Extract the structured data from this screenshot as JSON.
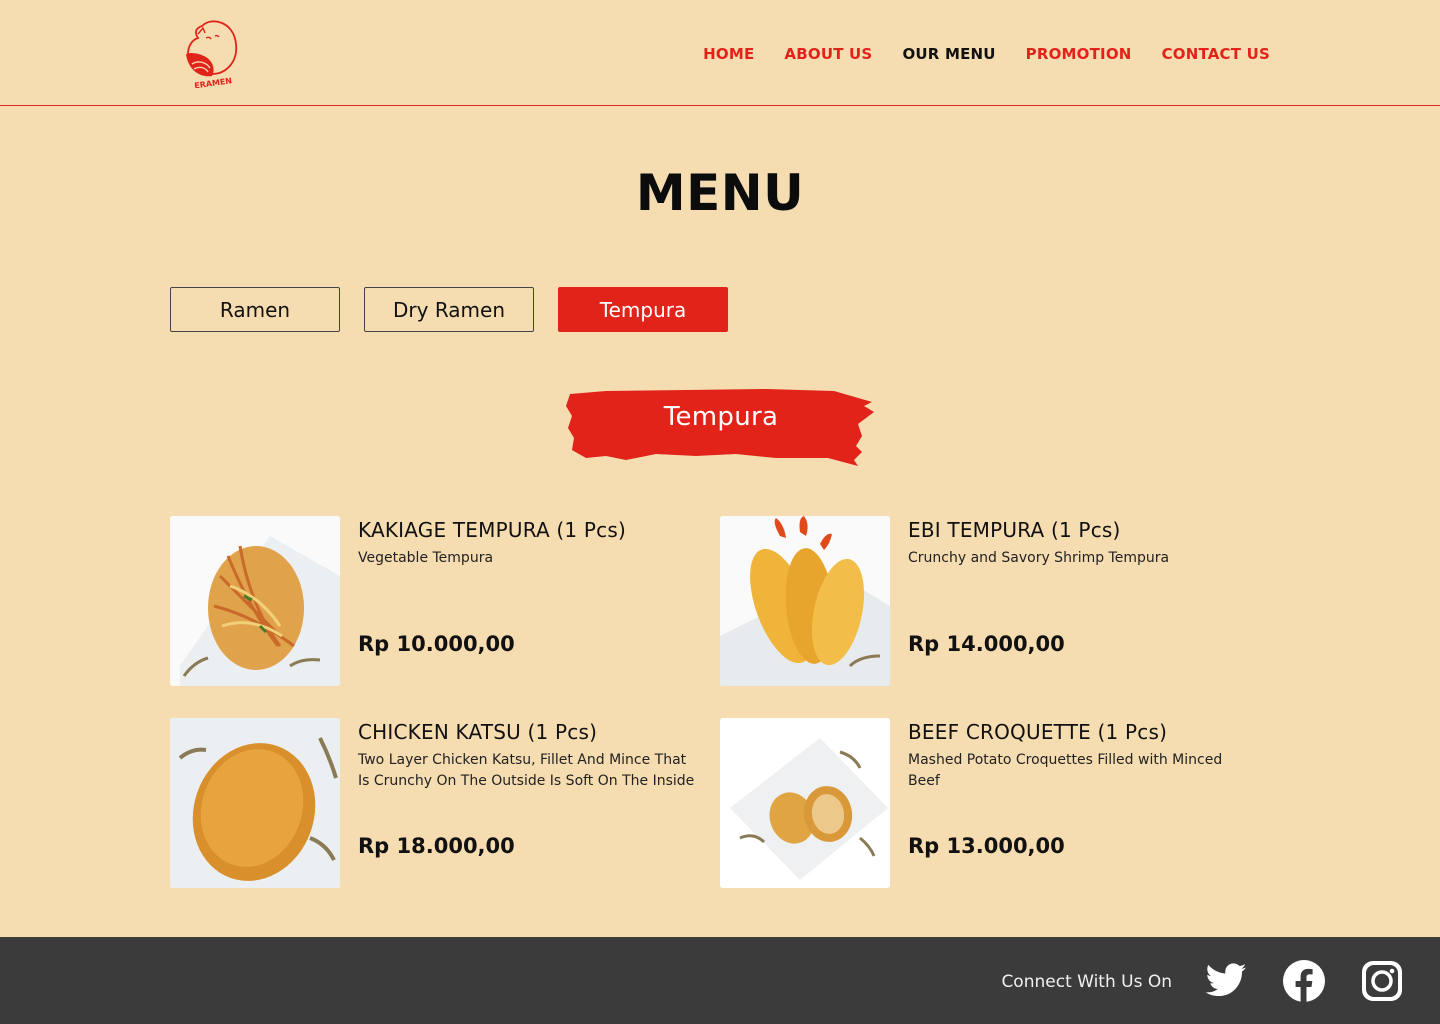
{
  "brand": {
    "logo_text": "ERAMEN",
    "accent": "#e2231a",
    "background": "#f6dcb1"
  },
  "nav": {
    "items": [
      {
        "label": "HOME"
      },
      {
        "label": "ABOUT US"
      },
      {
        "label": "OUR MENU"
      },
      {
        "label": "PROMOTION"
      },
      {
        "label": "CONTACT US"
      }
    ],
    "active": "OUR MENU"
  },
  "page": {
    "title": "MENU"
  },
  "tabs": [
    {
      "label": "Ramen"
    },
    {
      "label": "Dry Ramen"
    },
    {
      "label": "Tempura"
    }
  ],
  "active_tab": "Tempura",
  "section": {
    "title": "Tempura"
  },
  "items": [
    {
      "name": "KAKIAGE TEMPURA (1 Pcs)",
      "description": "Vegetable Tempura",
      "price": "Rp 10.000,00"
    },
    {
      "name": "EBI TEMPURA (1 Pcs)",
      "description": "Crunchy and Savory Shrimp Tempura",
      "price": "Rp 14.000,00"
    },
    {
      "name": "CHICKEN KATSU (1 Pcs)",
      "description": "Two Layer Chicken Katsu, Fillet And Mince That Is Crunchy On The Outside Is Soft On The Inside",
      "price": "Rp 18.000,00"
    },
    {
      "name": "BEEF CROQUETTE (1 Pcs)",
      "description": "Mashed Potato Croquettes Filled with Minced Beef",
      "price": "Rp 13.000,00"
    }
  ],
  "footer": {
    "connect_text": "Connect With Us On",
    "social_icons": [
      "twitter-icon",
      "facebook-icon",
      "instagram-icon"
    ]
  }
}
